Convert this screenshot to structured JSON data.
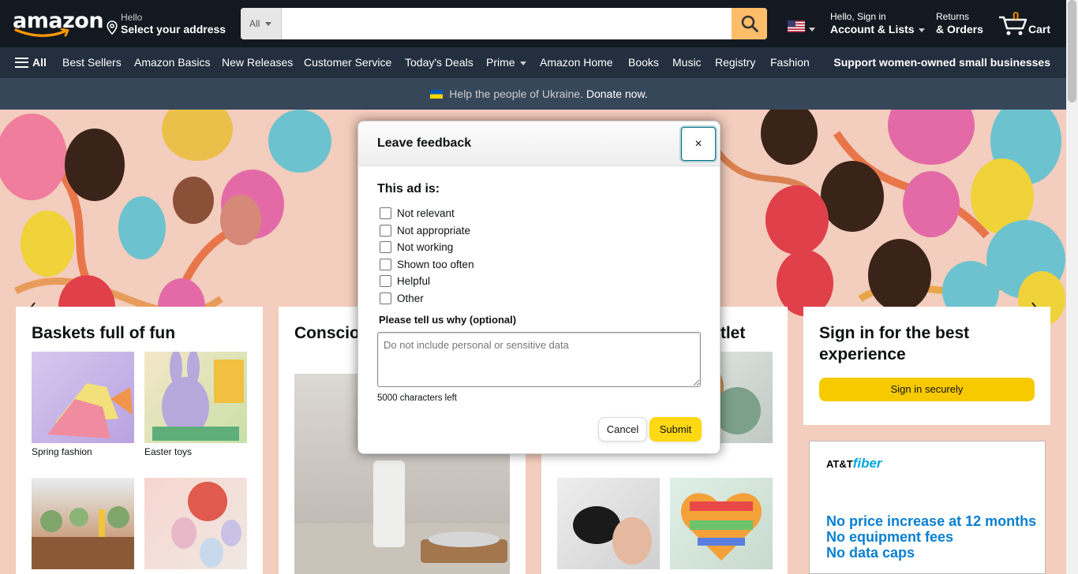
{
  "header": {
    "logo_text": "amazon",
    "address_line1": "Hello",
    "address_line2": "Select your address",
    "search_category": "All",
    "search_placeholder": "",
    "account_line1": "Hello, Sign in",
    "account_line2": "Account & Lists",
    "returns_line1": "Returns",
    "returns_line2": "& Orders",
    "cart_count": "0",
    "cart_label": "Cart"
  },
  "nav": {
    "all_label": "All",
    "links": [
      "Best Sellers",
      "Amazon Basics",
      "New Releases",
      "Customer Service",
      "Today's Deals",
      "Prime",
      "Amazon Home",
      "Books",
      "Music",
      "Registry",
      "Fashion"
    ],
    "promo": "Support women-owned small businesses"
  },
  "banner": {
    "text": "Help the people of Ukraine.",
    "link": "Donate now."
  },
  "cards": {
    "baskets": {
      "title": "Baskets full of fun",
      "tiles": [
        "Spring fashion",
        "Easter toys",
        "",
        ""
      ]
    },
    "conscious": {
      "title": "Conscious skincare"
    },
    "outlet": {
      "title": "utlet"
    },
    "signin": {
      "title": "Sign in for the best experience",
      "button": "Sign in securely"
    }
  },
  "ad": {
    "brand": "AT&T",
    "brand_sub": "fiber",
    "lines": [
      "No price increase at 12 months",
      "No equipment fees",
      "No data caps"
    ]
  },
  "modal": {
    "title": "Leave feedback",
    "close_label": "×",
    "section_label": "This ad is:",
    "options": [
      "Not relevant",
      "Not appropriate",
      "Not working",
      "Shown too often",
      "Helpful",
      "Other"
    ],
    "why_label": "Please tell us why (optional)",
    "why_placeholder": "Do not include personal or sensitive data",
    "chars_left": "5000 characters left",
    "cancel_label": "Cancel",
    "submit_label": "Submit"
  },
  "colors": {
    "nav_dark": "#131921",
    "nav_secondary": "#232f3e",
    "search_button": "#febd69",
    "submit": "#ffd814",
    "sign_in": "#f7ca00"
  }
}
